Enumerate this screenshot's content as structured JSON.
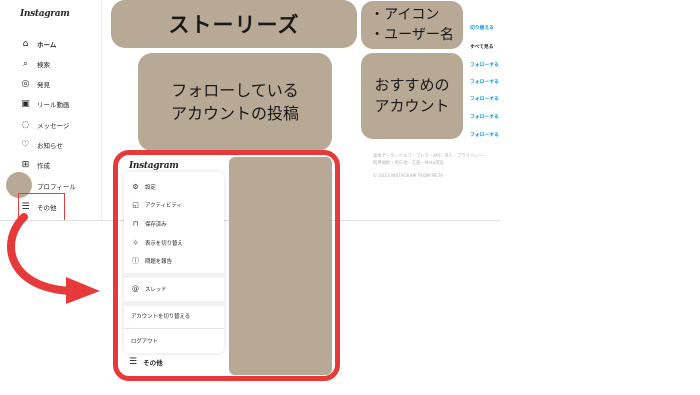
{
  "sidebar": {
    "logo": "Instagram",
    "items": [
      {
        "label": "ホーム",
        "icon": "home-icon",
        "glyph": "⌂"
      },
      {
        "label": "検索",
        "icon": "search-icon",
        "glyph": "⌕"
      },
      {
        "label": "発見",
        "icon": "compass-icon",
        "glyph": "◎"
      },
      {
        "label": "リール動画",
        "icon": "reels-icon",
        "glyph": "▣"
      },
      {
        "label": "メッセージ",
        "icon": "messenger-icon",
        "glyph": "◌"
      },
      {
        "label": "お知らせ",
        "icon": "heart-icon",
        "glyph": "♡"
      },
      {
        "label": "作成",
        "icon": "plus-square-icon",
        "glyph": "⊞"
      },
      {
        "label": "プロフィール",
        "icon": "avatar-icon",
        "glyph": ""
      },
      {
        "label": "その他",
        "icon": "hamburger-icon",
        "glyph": "☰"
      }
    ]
  },
  "placeholders": {
    "stories": "ストーリーズ",
    "posts_line1": "フォローしている",
    "posts_line2": "アカウントの投稿",
    "info_line1": "・アイコン",
    "info_line2": "・ユーザー名",
    "reco_line1": "おすすめの",
    "reco_line2": "アカウント"
  },
  "right": {
    "switch": "切り替える",
    "see_all": "すべて見る",
    "follow": "フォローする",
    "footer_line1": "基本データ・ヘルプ・プレス・API・求人・プライバシー・",
    "footer_line2": "利用規約・所在地・言語・Meta認証",
    "copyright": "© 2023 INSTAGRAM FROM META"
  },
  "menu": {
    "logo": "Instagram",
    "items": [
      {
        "label": "設定",
        "icon": "gear-icon",
        "glyph": "⚙"
      },
      {
        "label": "アクティビティ",
        "icon": "activity-icon",
        "glyph": "◱"
      },
      {
        "label": "保存済み",
        "icon": "bookmark-icon",
        "glyph": "⊓"
      },
      {
        "label": "表示を切り替え",
        "icon": "sun-icon",
        "glyph": "☼"
      },
      {
        "label": "問題を報告",
        "icon": "report-icon",
        "glyph": "ⓘ"
      }
    ],
    "threads": {
      "label": "スレッド",
      "icon": "threads-icon",
      "glyph": "@"
    },
    "switch_account": "アカウントを切り替える",
    "logout": "ログアウト",
    "more": "その他"
  },
  "colors": {
    "accent_red": "#e63a3a",
    "placeholder": "#b7a995",
    "link_blue": "#0095f6"
  }
}
